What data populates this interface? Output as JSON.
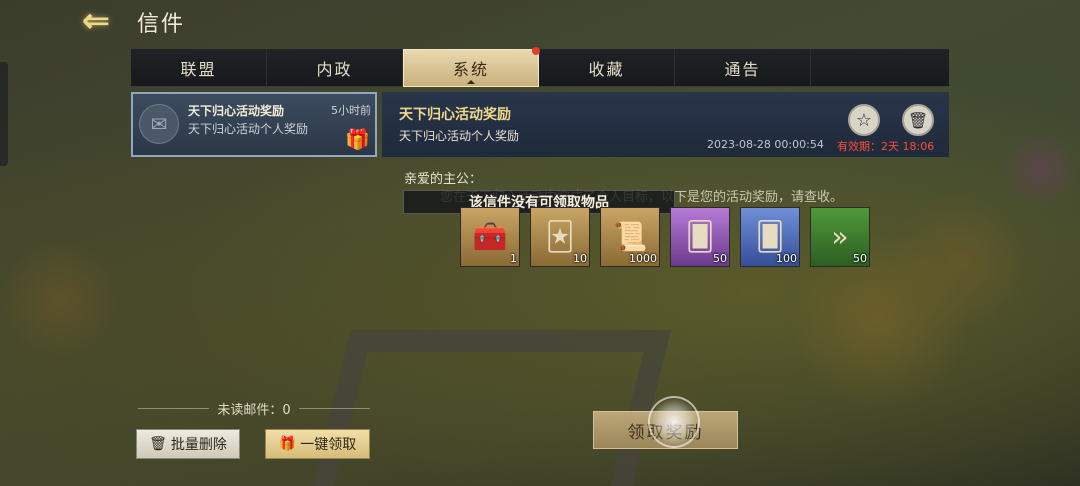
{
  "header": {
    "back_icon": "back-arrow-icon",
    "title": "信件"
  },
  "tabs": [
    {
      "label": "联盟",
      "active": false
    },
    {
      "label": "内政",
      "active": false
    },
    {
      "label": "系统",
      "active": true,
      "has_dot": true
    },
    {
      "label": "收藏",
      "active": false
    },
    {
      "label": "通告",
      "active": false
    }
  ],
  "mail_list": [
    {
      "title": "天下归心活动奖励",
      "time": "5小时前",
      "subtitle": "天下归心活动个人奖励",
      "icon": "envelope-icon",
      "attachment_icon": "gift-icon"
    }
  ],
  "detail": {
    "title": "天下归心活动奖励",
    "subtitle": "天下归心活动个人奖励",
    "date": "2023-08-28  00:00:54",
    "expiry": "有效期：2天  18:06",
    "favorite_icon": "star-icon",
    "delete_icon": "trash-icon",
    "greeting": "亲爱的主公：",
    "body": "您在天下归心活动中完成了个人目标，以下是您的活动奖励，请查收。",
    "toast": "该信件没有可领取物品"
  },
  "rewards": [
    {
      "icon": "treasure-chest-icon",
      "qty": "1"
    },
    {
      "icon": "gold-card-icon",
      "qty": "10"
    },
    {
      "icon": "scroll-icon",
      "qty": "1000"
    },
    {
      "icon": "purple-card-icon",
      "qty": "50"
    },
    {
      "icon": "blue-card-icon",
      "qty": "100"
    },
    {
      "icon": "speedup-icon",
      "qty": "50"
    }
  ],
  "footer": {
    "unread_label": "未读邮件：0",
    "batch_delete": "批量删除",
    "claim_all": "一键领取",
    "claim_reward": "领取奖励"
  },
  "colors": {
    "accent_gold": "#f0d88a",
    "expiry_red": "#ff4a3a",
    "tab_active": "#e9d9b0"
  }
}
